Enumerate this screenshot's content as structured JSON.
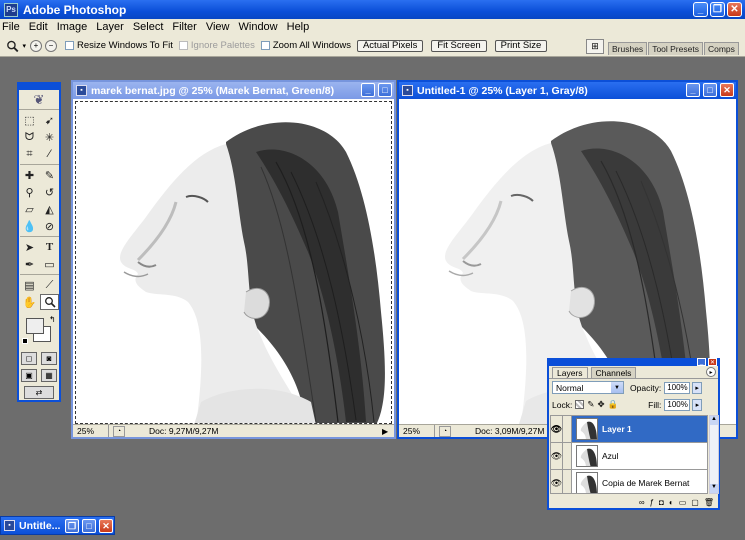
{
  "app": {
    "title": "Adobe Photoshop",
    "icon_label": "Ps"
  },
  "menu": [
    "File",
    "Edit",
    "Image",
    "Layer",
    "Select",
    "Filter",
    "View",
    "Window",
    "Help"
  ],
  "options": {
    "resize_label": "Resize Windows To Fit",
    "ignore_label": "Ignore Palettes",
    "zoom_all_label": "Zoom All Windows",
    "actual_pixels": "Actual Pixels",
    "fit_screen": "Fit Screen",
    "print_size": "Print Size"
  },
  "palette_well": [
    "Brushes",
    "Tool Presets",
    "Comps"
  ],
  "doc1": {
    "title": "marek bernat.jpg @ 25% (Marek Bernat, Green/8)",
    "zoom": "25%",
    "doc_size": "Doc: 9,27M/9,27M"
  },
  "doc2": {
    "title": "Untitled-1 @ 25% (Layer 1, Gray/8)",
    "zoom": "25%",
    "doc_size": "Doc: 3,09M/9,27M"
  },
  "layers_panel": {
    "tabs": [
      "Layers",
      "Channels"
    ],
    "blend_mode": "Normal",
    "opacity_label": "Opacity:",
    "opacity": "100%",
    "lock_label": "Lock:",
    "fill_label": "Fill:",
    "fill": "100%",
    "layers": [
      {
        "name": "Layer 1",
        "selected": true
      },
      {
        "name": "Azul",
        "selected": false
      },
      {
        "name": "Copia de Marek Bernat",
        "selected": false
      }
    ]
  },
  "minimized": {
    "title": "Untitle..."
  }
}
